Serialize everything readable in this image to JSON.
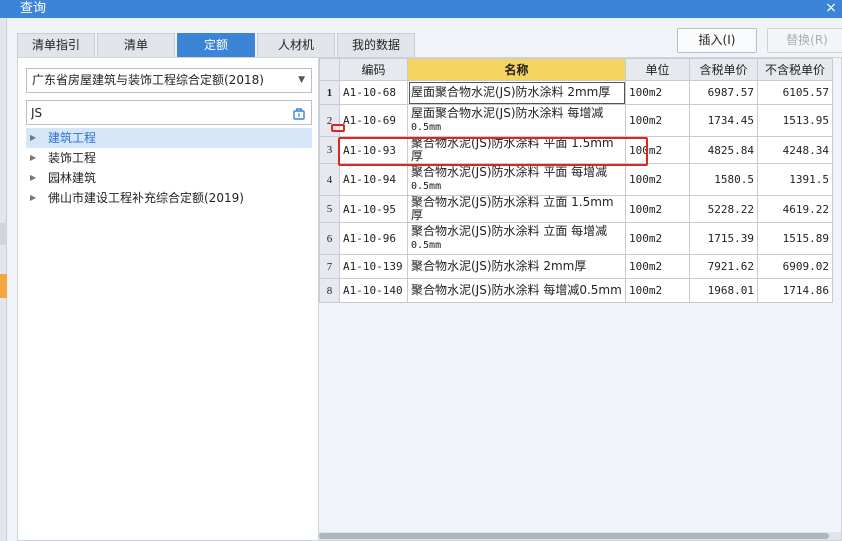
{
  "window": {
    "title": "查询",
    "close_glyph": "×"
  },
  "tabs": [
    {
      "label": "清单指引",
      "active": false
    },
    {
      "label": "清单",
      "active": false
    },
    {
      "label": "定额",
      "active": true
    },
    {
      "label": "人材机",
      "active": false
    },
    {
      "label": "我的数据",
      "active": false
    }
  ],
  "toolbar": {
    "insert_label": "插入(I)",
    "replace_label": "替换(R)"
  },
  "left": {
    "quota_library": "广东省房屋建筑与装饰工程综合定额(2018)",
    "search_value": "JS",
    "tree": [
      {
        "label": "建筑工程",
        "selected": true
      },
      {
        "label": "装饰工程",
        "selected": false
      },
      {
        "label": "园林建筑",
        "selected": false
      },
      {
        "label": "佛山市建设工程补充综合定额(2019)",
        "selected": false
      }
    ]
  },
  "grid": {
    "headers": {
      "code": "编码",
      "name": "名称",
      "unit": "单位",
      "tax_price": "含税单价",
      "notax_price": "不含税单价"
    },
    "rows": [
      {
        "no": "1",
        "code": "A1-10-68",
        "name": "屋面聚合物水泥(JS)防水涂料 2mm厚",
        "name_sub": "",
        "unit": "100m2",
        "tax_price": "6987.57",
        "notax_price": "6105.57"
      },
      {
        "no": "2",
        "code": "A1-10-69",
        "name": "屋面聚合物水泥(JS)防水涂料 每增减",
        "name_sub": "0.5mm",
        "unit": "100m2",
        "tax_price": "1734.45",
        "notax_price": "1513.95"
      },
      {
        "no": "3",
        "code": "A1-10-93",
        "name": "聚合物水泥(JS)防水涂料 平面 1.5mm厚",
        "name_sub": "",
        "unit": "100m2",
        "tax_price": "4825.84",
        "notax_price": "4248.34"
      },
      {
        "no": "4",
        "code": "A1-10-94",
        "name": "聚合物水泥(JS)防水涂料 平面 每增减",
        "name_sub": "0.5mm",
        "unit": "100m2",
        "tax_price": "1580.5",
        "notax_price": "1391.5"
      },
      {
        "no": "5",
        "code": "A1-10-95",
        "name": "聚合物水泥(JS)防水涂料 立面 1.5mm厚",
        "name_sub": "",
        "unit": "100m2",
        "tax_price": "5228.22",
        "notax_price": "4619.22"
      },
      {
        "no": "6",
        "code": "A1-10-96",
        "name": "聚合物水泥(JS)防水涂料 立面 每增减",
        "name_sub": "0.5mm",
        "unit": "100m2",
        "tax_price": "1715.39",
        "notax_price": "1515.89"
      },
      {
        "no": "7",
        "code": "A1-10-139",
        "name": "聚合物水泥(JS)防水涂料 2mm厚",
        "name_sub": "",
        "unit": "100m2",
        "tax_price": "7921.62",
        "notax_price": "6909.02"
      },
      {
        "no": "8",
        "code": "A1-10-140",
        "name": "聚合物水泥(JS)防水涂料 每增减0.5mm",
        "name_sub": "",
        "unit": "100m2",
        "tax_price": "1968.01",
        "notax_price": "1714.86"
      }
    ]
  },
  "colors": {
    "accent": "#3b84d8",
    "highlight": "#e0251f",
    "name_header": "#f5d45f",
    "selection": "#d4e6f8"
  },
  "icons": {
    "close": "close-icon",
    "tree_expand": "triangle-right-icon",
    "dropdown": "chevron-down-icon",
    "search_action": "search-clear-icon"
  }
}
